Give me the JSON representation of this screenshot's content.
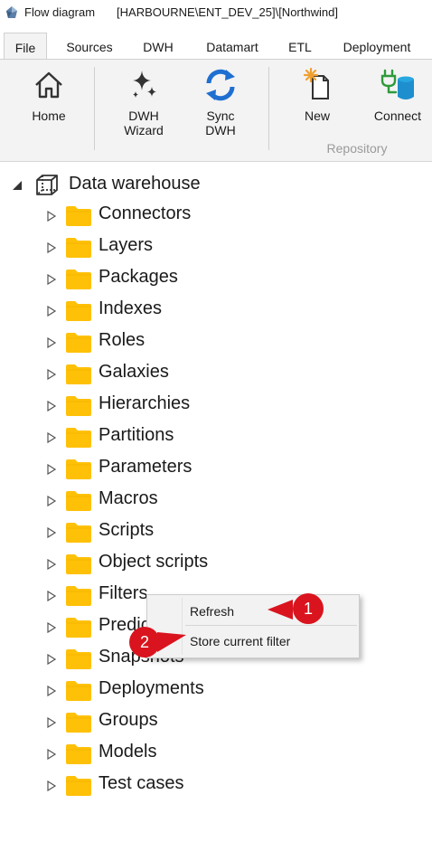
{
  "window": {
    "title": "Flow diagram",
    "context": "[HARBOURNE\\ENT_DEV_25]\\[Northwind]"
  },
  "tabs": [
    {
      "label": "File",
      "active": true
    },
    {
      "label": "Sources",
      "active": false
    },
    {
      "label": "DWH",
      "active": false
    },
    {
      "label": "Datamart",
      "active": false
    },
    {
      "label": "ETL",
      "active": false
    },
    {
      "label": "Deployment",
      "active": false
    }
  ],
  "ribbon": {
    "home": "Home",
    "dwh_wizard": "DWH\nWizard",
    "sync_dwh": "Sync\nDWH",
    "new": "New",
    "connect": "Connect",
    "group_label": "Repository"
  },
  "tree": {
    "root": "Data warehouse",
    "items": [
      "Connectors",
      "Layers",
      "Packages",
      "Indexes",
      "Roles",
      "Galaxies",
      "Hierarchies",
      "Partitions",
      "Parameters",
      "Macros",
      "Scripts",
      "Object scripts",
      "Filters",
      "Predicates",
      "Snapshots",
      "Deployments",
      "Groups",
      "Models",
      "Test cases"
    ]
  },
  "context_menu": {
    "items": [
      "Refresh",
      "Store current filter"
    ]
  },
  "callouts": [
    "1",
    "2"
  ],
  "colors": {
    "folder": "#ffc107",
    "callout": "#d9141e",
    "sync_blue": "#1f6fd1",
    "new_accent": "#f0a030",
    "connect_green": "#2e9a3c"
  }
}
